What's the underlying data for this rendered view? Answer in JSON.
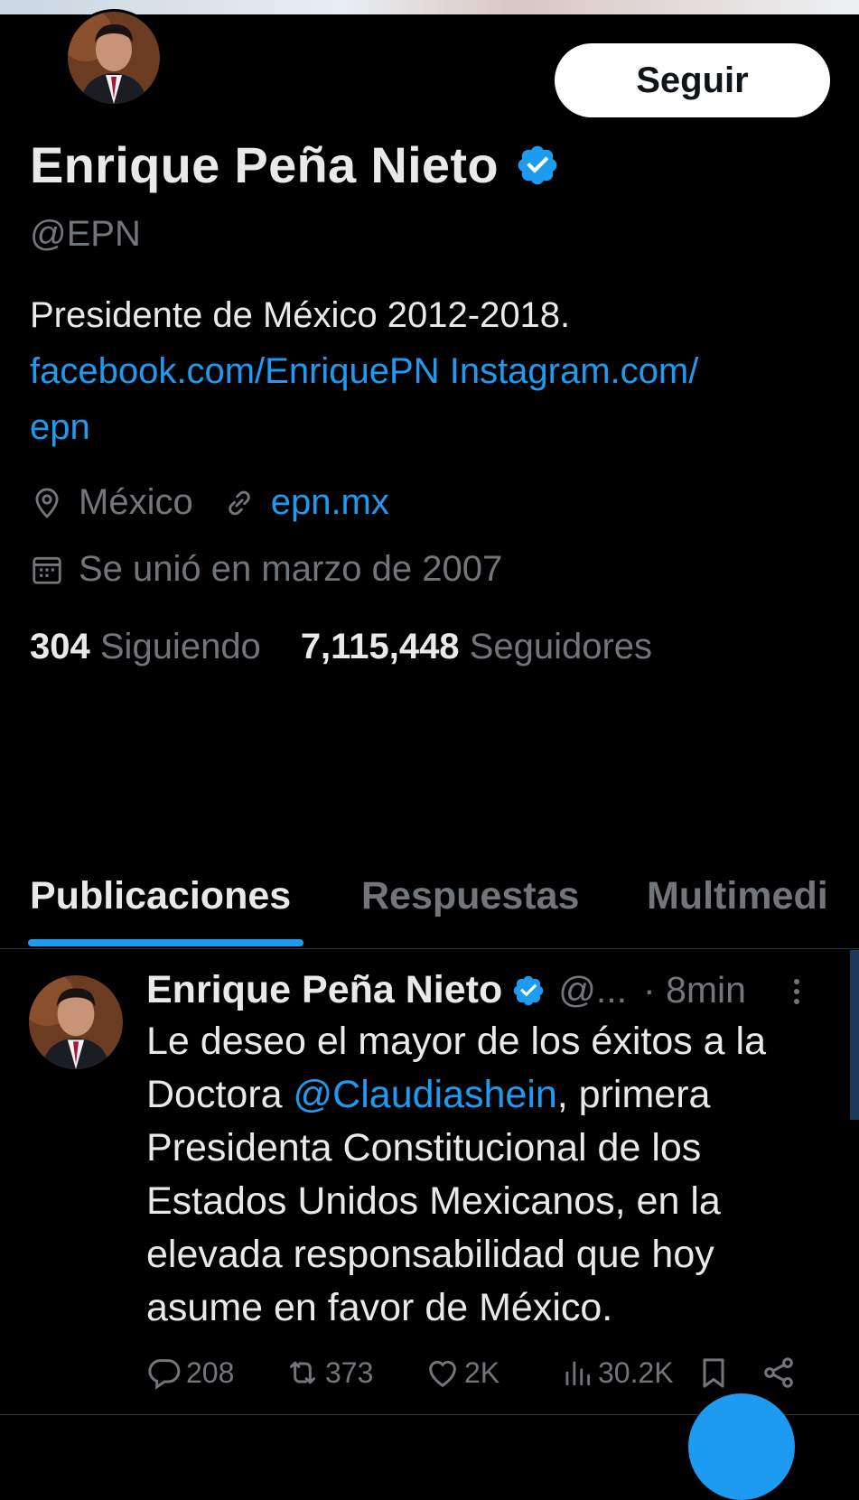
{
  "profile": {
    "display_name": "Enrique Peña Nieto",
    "handle": "@EPN",
    "follow_label": "Seguir",
    "bio_text": "Presidente de México 2012-2018.",
    "bio_link_1": "facebook.com/EnriquePN",
    "bio_link_2": "Instagram.com/",
    "bio_link_2_cont": "epn",
    "location": "México",
    "website": "epn.mx",
    "joined": "Se unió en marzo de 2007",
    "following_count": "304",
    "following_label": "Siguiendo",
    "followers_count": "7,115,448",
    "followers_label": "Seguidores"
  },
  "tabs": [
    {
      "label": "Publicaciones",
      "active": true
    },
    {
      "label": "Respuestas",
      "active": false
    },
    {
      "label": "Multimedi",
      "active": false
    }
  ],
  "post": {
    "author": "Enrique Peña Nieto",
    "handle": "@...",
    "time": "· 8min",
    "text_1": "Le deseo el mayor de los éxitos a la Doctora ",
    "mention": "@Claudiashein",
    "text_2": ", primera Presidenta Constitucional de los Estados Unidos Mexicanos, en la elevada responsabilidad que hoy asume en favor de México.",
    "replies": "208",
    "reposts": "373",
    "likes": "2K",
    "views": "30.2K"
  },
  "colors": {
    "accent": "#1d9bf0",
    "text": "#e7e9ea",
    "muted": "#71767b",
    "background": "#000000"
  },
  "icons": [
    "verified-badge-icon",
    "location-pin-icon",
    "link-icon",
    "calendar-icon",
    "reply-icon",
    "repost-icon",
    "like-icon",
    "views-icon",
    "bookmark-icon",
    "share-icon",
    "more-icon"
  ]
}
